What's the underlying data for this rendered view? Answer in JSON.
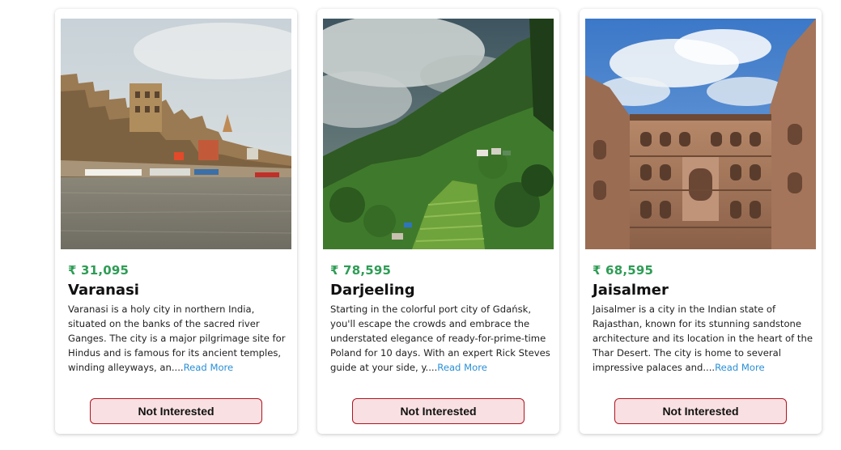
{
  "tours": [
    {
      "price": "₹ 31,095",
      "name": "Varanasi",
      "description": "Varanasi is a holy city in northern India, situated on the banks of the sacred river Ganges. The city is a major pilgrimage site for Hindus and is famous for its ancient temples, winding alleyways, an....",
      "read_more": "Read More",
      "button": "Not Interested",
      "image_subject": "riverside ghats with buildings and boats"
    },
    {
      "price": "₹ 78,595",
      "name": "Darjeeling",
      "description": "Starting in the colorful port city of Gdańsk, you'll escape the crowds and embrace the understated elegance of ready-for-prime-time Poland for 10 days. With an expert Rick Steves guide at your side, y....",
      "read_more": "Read More",
      "button": "Not Interested",
      "image_subject": "misty green hills with terraced fields"
    },
    {
      "price": "₹ 68,595",
      "name": "Jaisalmer",
      "description": "Jaisalmer is a city in the Indian state of Rajasthan, known for its stunning sandstone architecture and its location in the heart of the Thar Desert. The city is home to several impressive palaces and....",
      "read_more": "Read More",
      "button": "Not Interested",
      "image_subject": "ornate sandstone palace courtyard under blue sky"
    }
  ],
  "colors": {
    "price": "#2e9c55",
    "link": "#2a8fd6",
    "button_bg": "#f9e1e3",
    "button_border": "#b0151f"
  }
}
